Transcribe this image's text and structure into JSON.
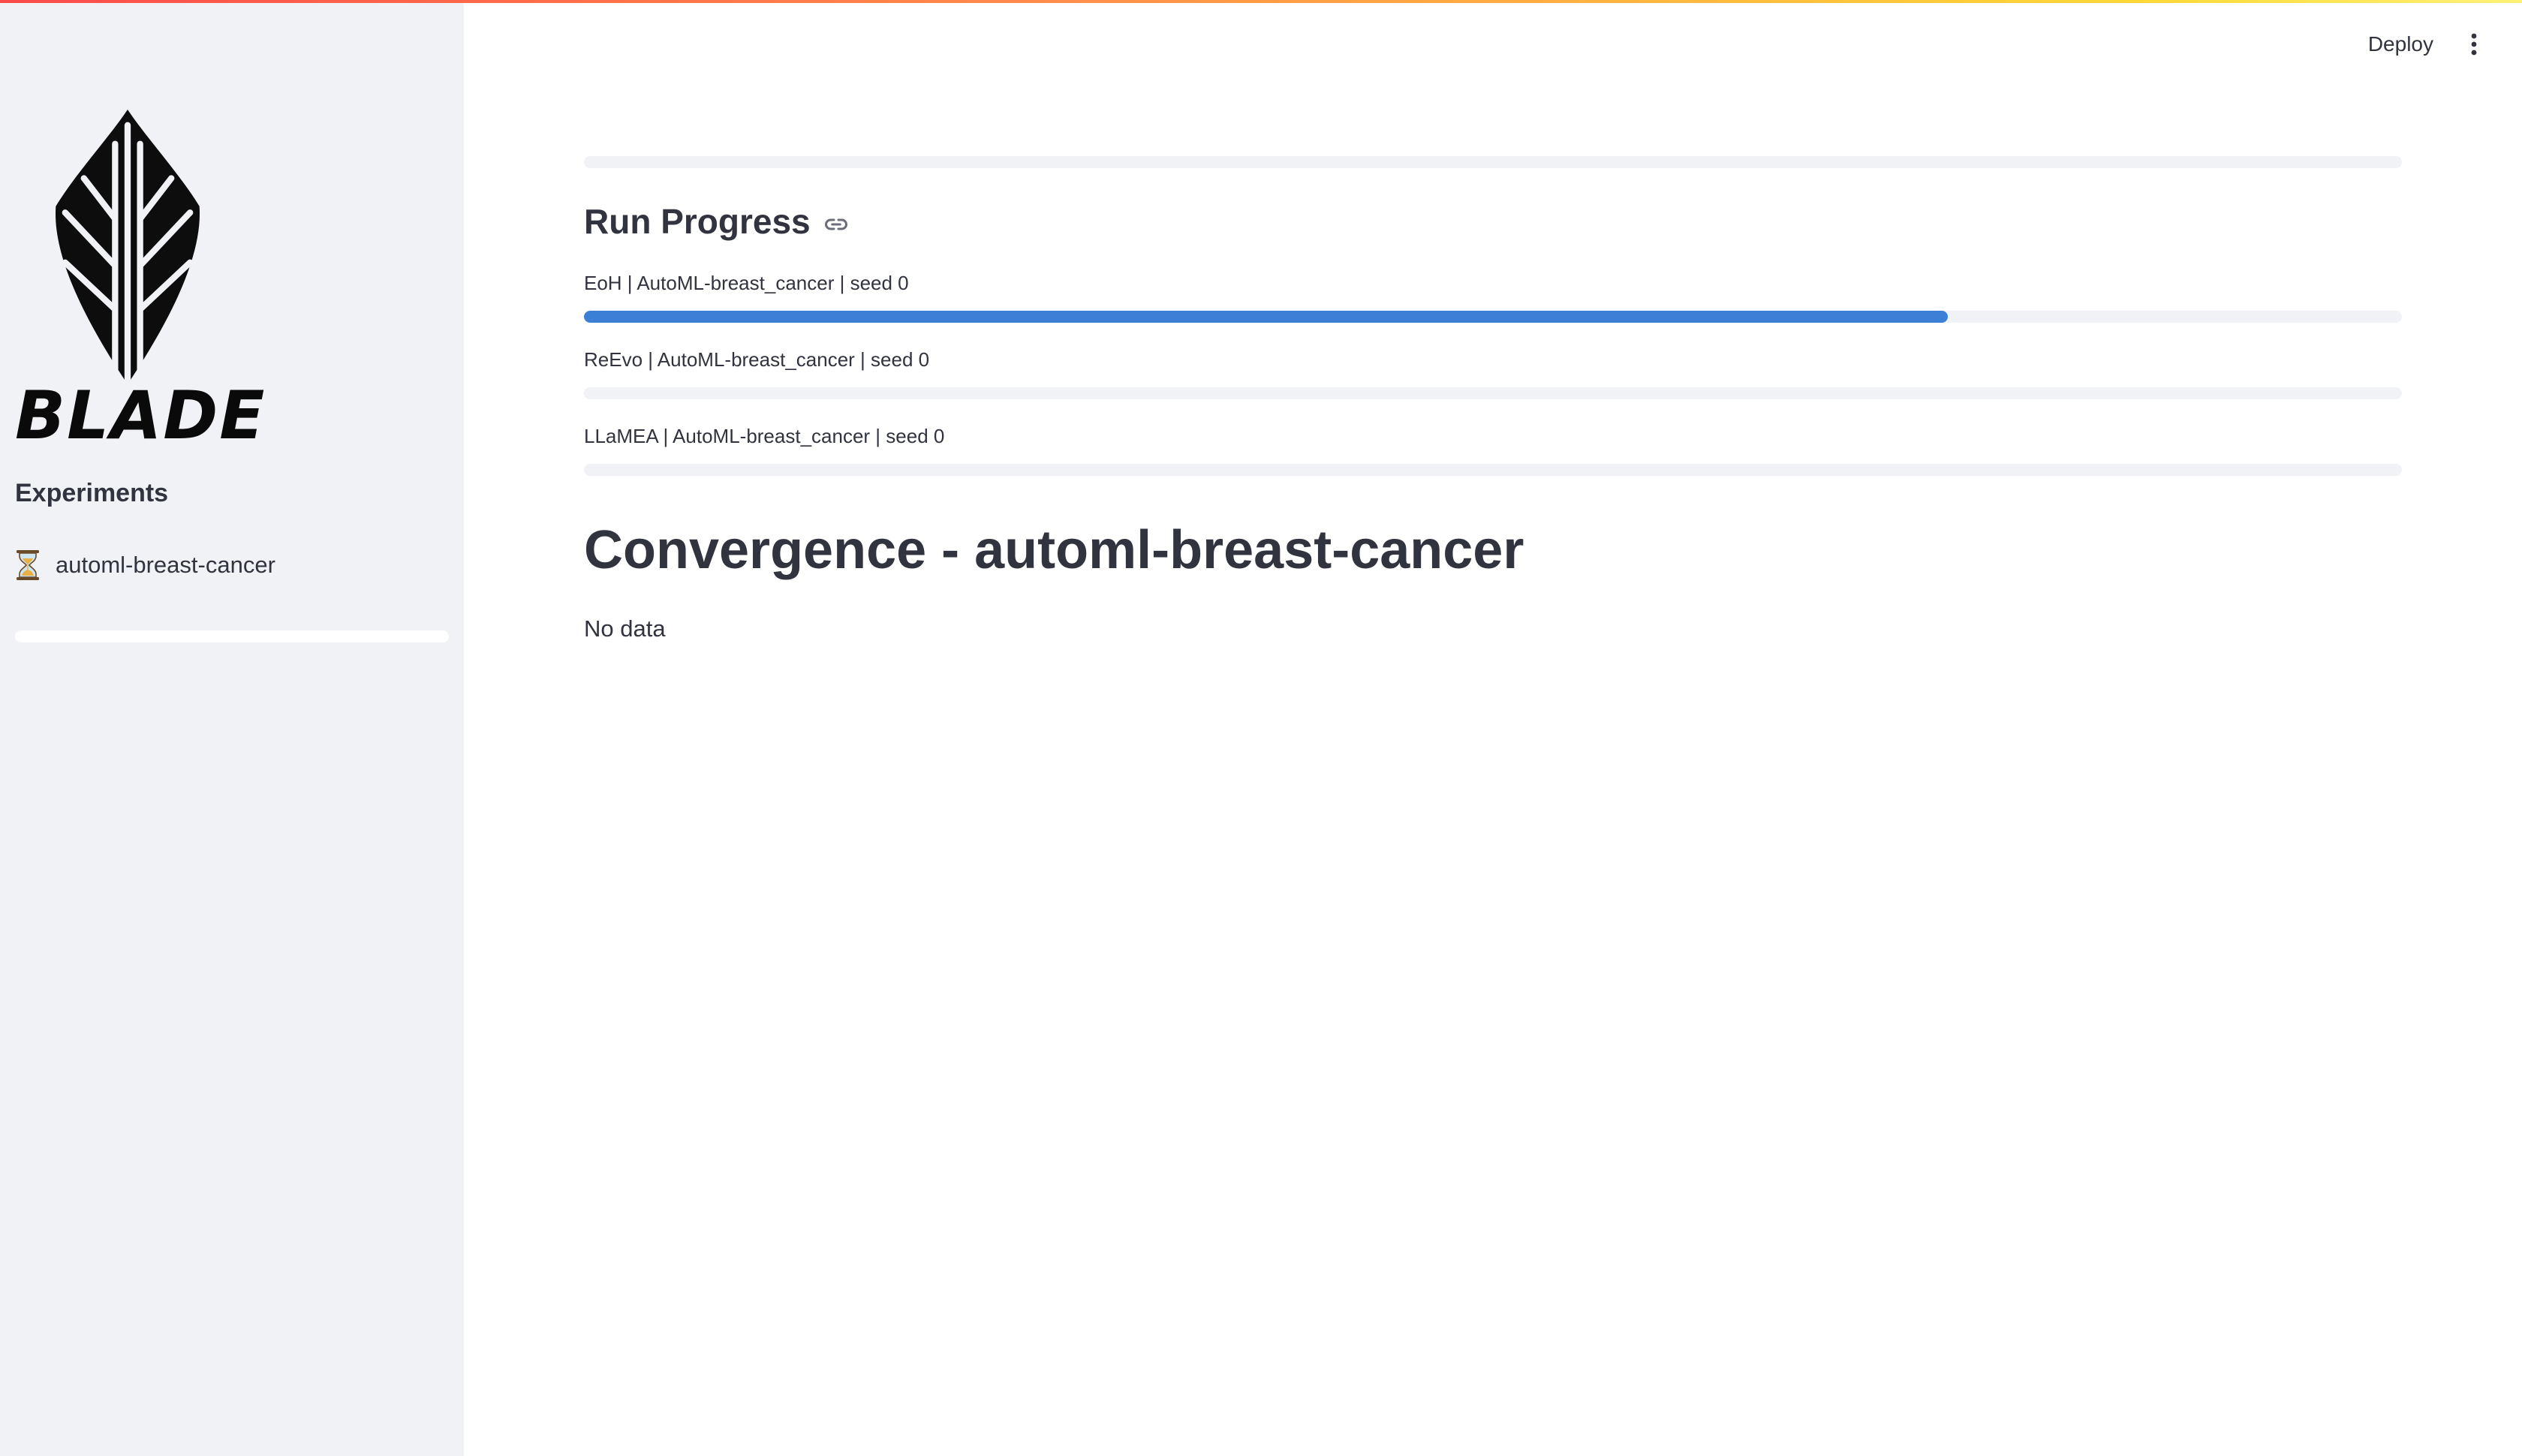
{
  "app": {
    "brand": "BLADE"
  },
  "header": {
    "deploy_label": "Deploy",
    "menu_icon": "more-vertical-icon"
  },
  "sidebar": {
    "heading": "Experiments",
    "experiments": [
      {
        "label": "automl-breast-cancer",
        "icon": "hourglass-icon",
        "status": "running"
      }
    ],
    "overall_progress": 0.0
  },
  "main": {
    "top_progress": 0.0,
    "run_progress": {
      "title": "Run Progress",
      "icon": "link-icon",
      "runs": [
        {
          "label": "EoH | AutoML-breast_cancer | seed 0",
          "progress": 0.75
        },
        {
          "label": "ReEvo | AutoML-breast_cancer | seed 0",
          "progress": 0.0
        },
        {
          "label": "LLaMEA | AutoML-breast_cancer | seed 0",
          "progress": 0.0
        }
      ]
    },
    "convergence": {
      "title": "Convergence - automl-breast-cancer",
      "empty_text": "No data"
    }
  },
  "colors": {
    "accent": "#3c7fd6",
    "sidebar_bg": "#f0f2f6",
    "text": "#31333f"
  }
}
